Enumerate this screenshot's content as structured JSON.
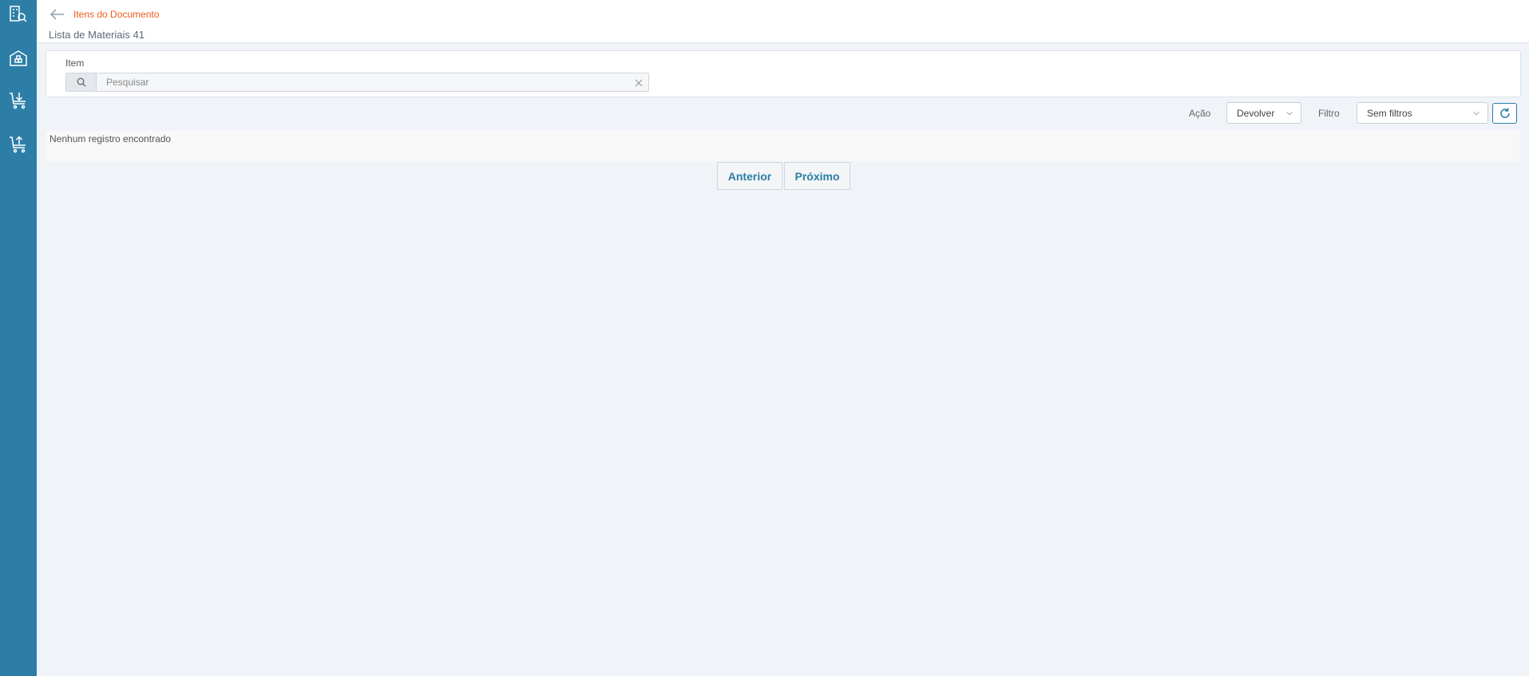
{
  "sidebar": {
    "items": [
      {
        "icon": "building-search-icon"
      },
      {
        "icon": "warehouse-icon"
      },
      {
        "icon": "cart-download-icon"
      },
      {
        "icon": "cart-upload-icon"
      }
    ]
  },
  "header": {
    "breadcrumb": "Itens do Documento",
    "title": "Lista de Materiais 41"
  },
  "search": {
    "label": "Item",
    "placeholder": "Pesquisar",
    "value": ""
  },
  "toolbar": {
    "action_label": "Ação",
    "action_value": "Devolver",
    "filter_label": "Filtro",
    "filter_value": "Sem filtros"
  },
  "results": {
    "empty_message": "Nenhum registro encontrado"
  },
  "pagination": {
    "prev_label": "Anterior",
    "next_label": "Próximo"
  },
  "colors": {
    "sidebar": "#2d7ea6",
    "accent": "#2d7ea6",
    "breadcrumb": "#f05a1e",
    "background": "#f0f3f8"
  }
}
